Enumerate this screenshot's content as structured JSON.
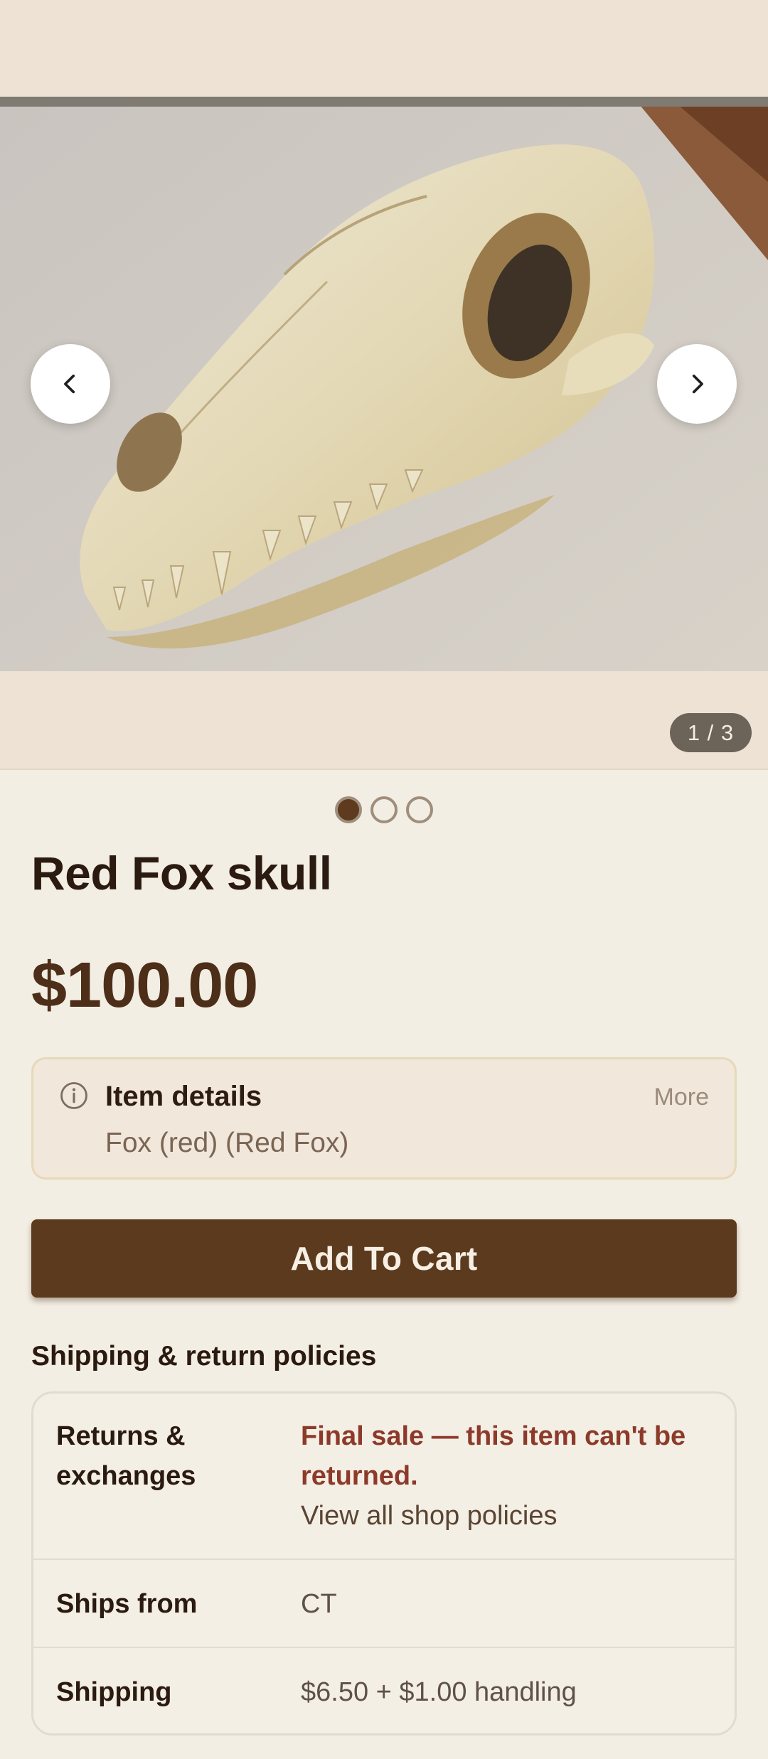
{
  "gallery": {
    "counter": "1 / 3",
    "prev_label": "Previous image",
    "next_label": "Next image",
    "dots": 3,
    "active_dot": 0
  },
  "product": {
    "title": "Red Fox skull",
    "price": "$100.00"
  },
  "details": {
    "heading": "Item details",
    "more": "More",
    "value": "Fox (red) (Red Fox)"
  },
  "cart": {
    "label": "Add To Cart"
  },
  "policies": {
    "heading": "Shipping & return policies",
    "rows": [
      {
        "label": "Returns & exchanges",
        "value": "Final sale — this item can't be returned.",
        "link": "View all shop policies"
      },
      {
        "label": "Ships from",
        "value": "CT"
      },
      {
        "label": "Shipping",
        "value": "$6.50 + $1.00 handling"
      }
    ]
  },
  "colors": {
    "background": "#f3eee3",
    "brand_brown": "#5b3a1e",
    "final_sale": "#8c3a2a",
    "counter_bg": "#6c6359"
  },
  "icons": [
    "chevron-left-icon",
    "chevron-right-icon",
    "info-icon"
  ]
}
